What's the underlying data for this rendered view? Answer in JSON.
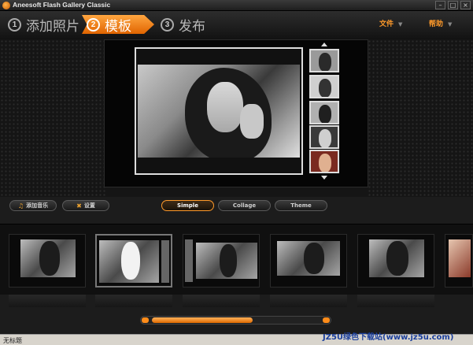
{
  "window": {
    "title": "Aneesoft Flash Gallery Classic"
  },
  "steps": [
    {
      "num": "1",
      "label": "添加照片"
    },
    {
      "num": "2",
      "label": "模板"
    },
    {
      "num": "3",
      "label": "发布"
    }
  ],
  "menu": {
    "file": "文件",
    "help": "帮助"
  },
  "toolbar": {
    "add_music": "添加音乐",
    "settings": "设置"
  },
  "styles": [
    "Simple",
    "Collage",
    "Theme"
  ],
  "active_style": "Simple",
  "status": {
    "text": "无标题"
  },
  "watermark": "JZ5U绿色下载站(www.jz5u.com)",
  "colors": {
    "accent": "#ff8c1a",
    "background": "#1c1c1c"
  }
}
